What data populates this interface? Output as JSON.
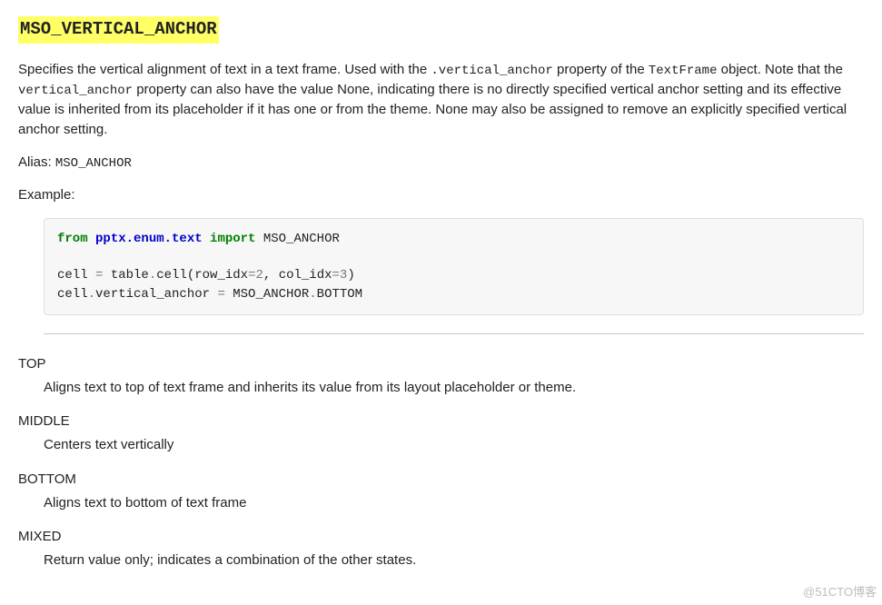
{
  "title": "MSO_VERTICAL_ANCHOR",
  "intro": {
    "pre1": "Specifies the vertical alignment of text in a text frame. Used with the ",
    "code1": ".vertical_anchor",
    "mid1": " property of the ",
    "code2": "TextFrame",
    "post1": " object. Note that the ",
    "code3": "vertical_anchor",
    "post2": " property can also have the value None, indicating there is no directly specified vertical anchor setting and its effective value is inherited from its placeholder if it has one or from the theme. None may also be assigned to remove an explicitly specified vertical anchor setting."
  },
  "alias_label": "Alias: ",
  "alias_value": "MSO_ANCHOR",
  "example_label": "Example:",
  "code": {
    "kw_from": "from",
    "module": "pptx.enum.text",
    "kw_import": "import",
    "imported": "MSO_ANCHOR",
    "l2a": "cell ",
    "l2op": "=",
    "l2b": " table",
    "l2dot1": ".",
    "l2c": "cell(row_idx",
    "l2eq1": "=",
    "l2n1": "2",
    "l2comma": ", col_idx",
    "l2eq2": "=",
    "l2n2": "3",
    "l2close": ")",
    "l3a": "cell",
    "l3dot": ".",
    "l3b": "vertical_anchor ",
    "l3op": "=",
    "l3c": " MSO_ANCHOR",
    "l3dot2": ".",
    "l3d": "BOTTOM"
  },
  "defs": [
    {
      "term": "TOP",
      "desc": "Aligns text to top of text frame and inherits its value from its layout placeholder or theme."
    },
    {
      "term": "MIDDLE",
      "desc": "Centers text vertically"
    },
    {
      "term": "BOTTOM",
      "desc": "Aligns text to bottom of text frame"
    },
    {
      "term": "MIXED",
      "desc": "Return value only; indicates a combination of the other states."
    }
  ],
  "watermark": "@51CTO博客"
}
